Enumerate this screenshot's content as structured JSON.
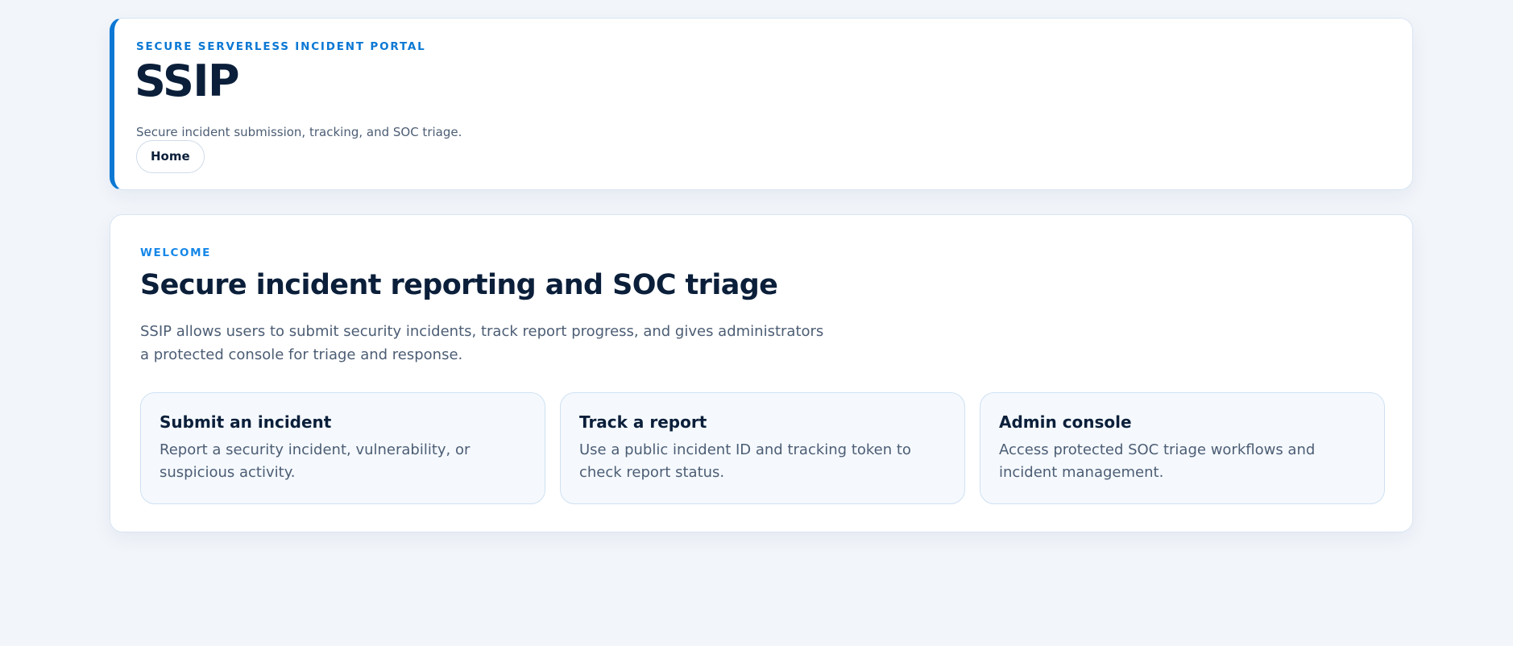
{
  "header": {
    "eyebrow": "SECURE SERVERLESS INCIDENT PORTAL",
    "title": "SSIP",
    "subtitle": "Secure incident submission, tracking, and SOC triage.",
    "nav": {
      "home_label": "Home"
    }
  },
  "welcome": {
    "eyebrow": "WELCOME",
    "title": "Secure incident reporting and SOC triage",
    "description": "SSIP allows users to submit security incidents, track report progress, and gives administrators a protected console for triage and response.",
    "cards": [
      {
        "title": "Submit an incident",
        "description": "Report a security incident, vulnerability, or suspicious activity."
      },
      {
        "title": "Track a report",
        "description": "Use a public incident ID and tracking token to check report status."
      },
      {
        "title": "Admin console",
        "description": "Access protected SOC triage workflows and incident management."
      }
    ]
  },
  "colors": {
    "accent": "#0b78d4",
    "background": "#f2f6fb",
    "heading": "#0b1f3a",
    "muted_text": "#4c5d74",
    "card_background": "#f5f9fe"
  }
}
